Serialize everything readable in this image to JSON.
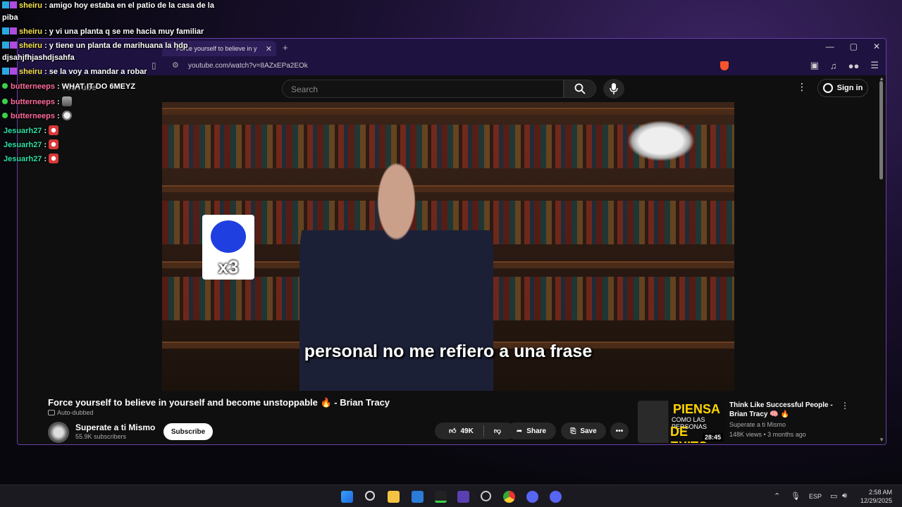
{
  "chat": [
    {
      "user": "sheiru",
      "text": ": amigo hoy estaba en el patio de la casa de la"
    },
    {
      "user": "",
      "text": "piba"
    },
    {
      "user": "sheiru",
      "text": ": y vi una planta q se me hacia muy familiar"
    },
    {
      "user": "sheiru",
      "text": ": y tiene un planta de marihuana la hdp"
    },
    {
      "user": "",
      "text": "djsahjfhjashdjsahfa"
    },
    {
      "user": "sheiru",
      "text": ": se la voy a mandar a robar"
    },
    {
      "user": "butterneeps",
      "text": ": WHAT IT DO 6MEYZ"
    },
    {
      "user": "butterneeps",
      "text": ":"
    },
    {
      "user": "butterneeps",
      "text": ":"
    },
    {
      "user": "Jesuarh27",
      "text": ":"
    },
    {
      "user": "Jesuarh27",
      "text": ":"
    },
    {
      "user": "Jesuarh27",
      "text": ":"
    }
  ],
  "browser": {
    "tab_title": "Force yourself to believe in y",
    "url": "youtube.com/watch?v=8AZxEPa2EOk"
  },
  "youtube": {
    "logo": "YouTube",
    "search_placeholder": "Search",
    "sign_in": "Sign in",
    "subtitle": "personal no me refiero a una frase",
    "emote_label": "x3",
    "video_title": "Force yourself to believe in yourself and become unstoppable 🔥 - Brian Tracy",
    "auto_dubbed": "Auto-dubbed",
    "channel_name": "Superate a ti Mismo",
    "channel_subs": "55.9K subscribers",
    "subscribe": "Subscribe",
    "likes": "49K",
    "share": "Share",
    "save": "Save",
    "recommended": {
      "thumb_line1": "PIENSA",
      "thumb_line2": "COMO LAS PERSONAS",
      "thumb_line3": "DE EXITO",
      "duration": "28:45",
      "title": "Think Like Successful People - Brian Tracy 🧠 🔥",
      "channel": "Superate a ti Mismo",
      "meta": "148K views • 3 months ago"
    }
  },
  "taskbar": {
    "lang": "ESP",
    "time": "2:58 AM",
    "date": "12/29/2025"
  },
  "colors": {
    "accent_border": "#6a3fa8",
    "sheiru": "#f4e24b",
    "butterneeps": "#ff6c9a",
    "jesuarh27": "#2fe0a5"
  }
}
